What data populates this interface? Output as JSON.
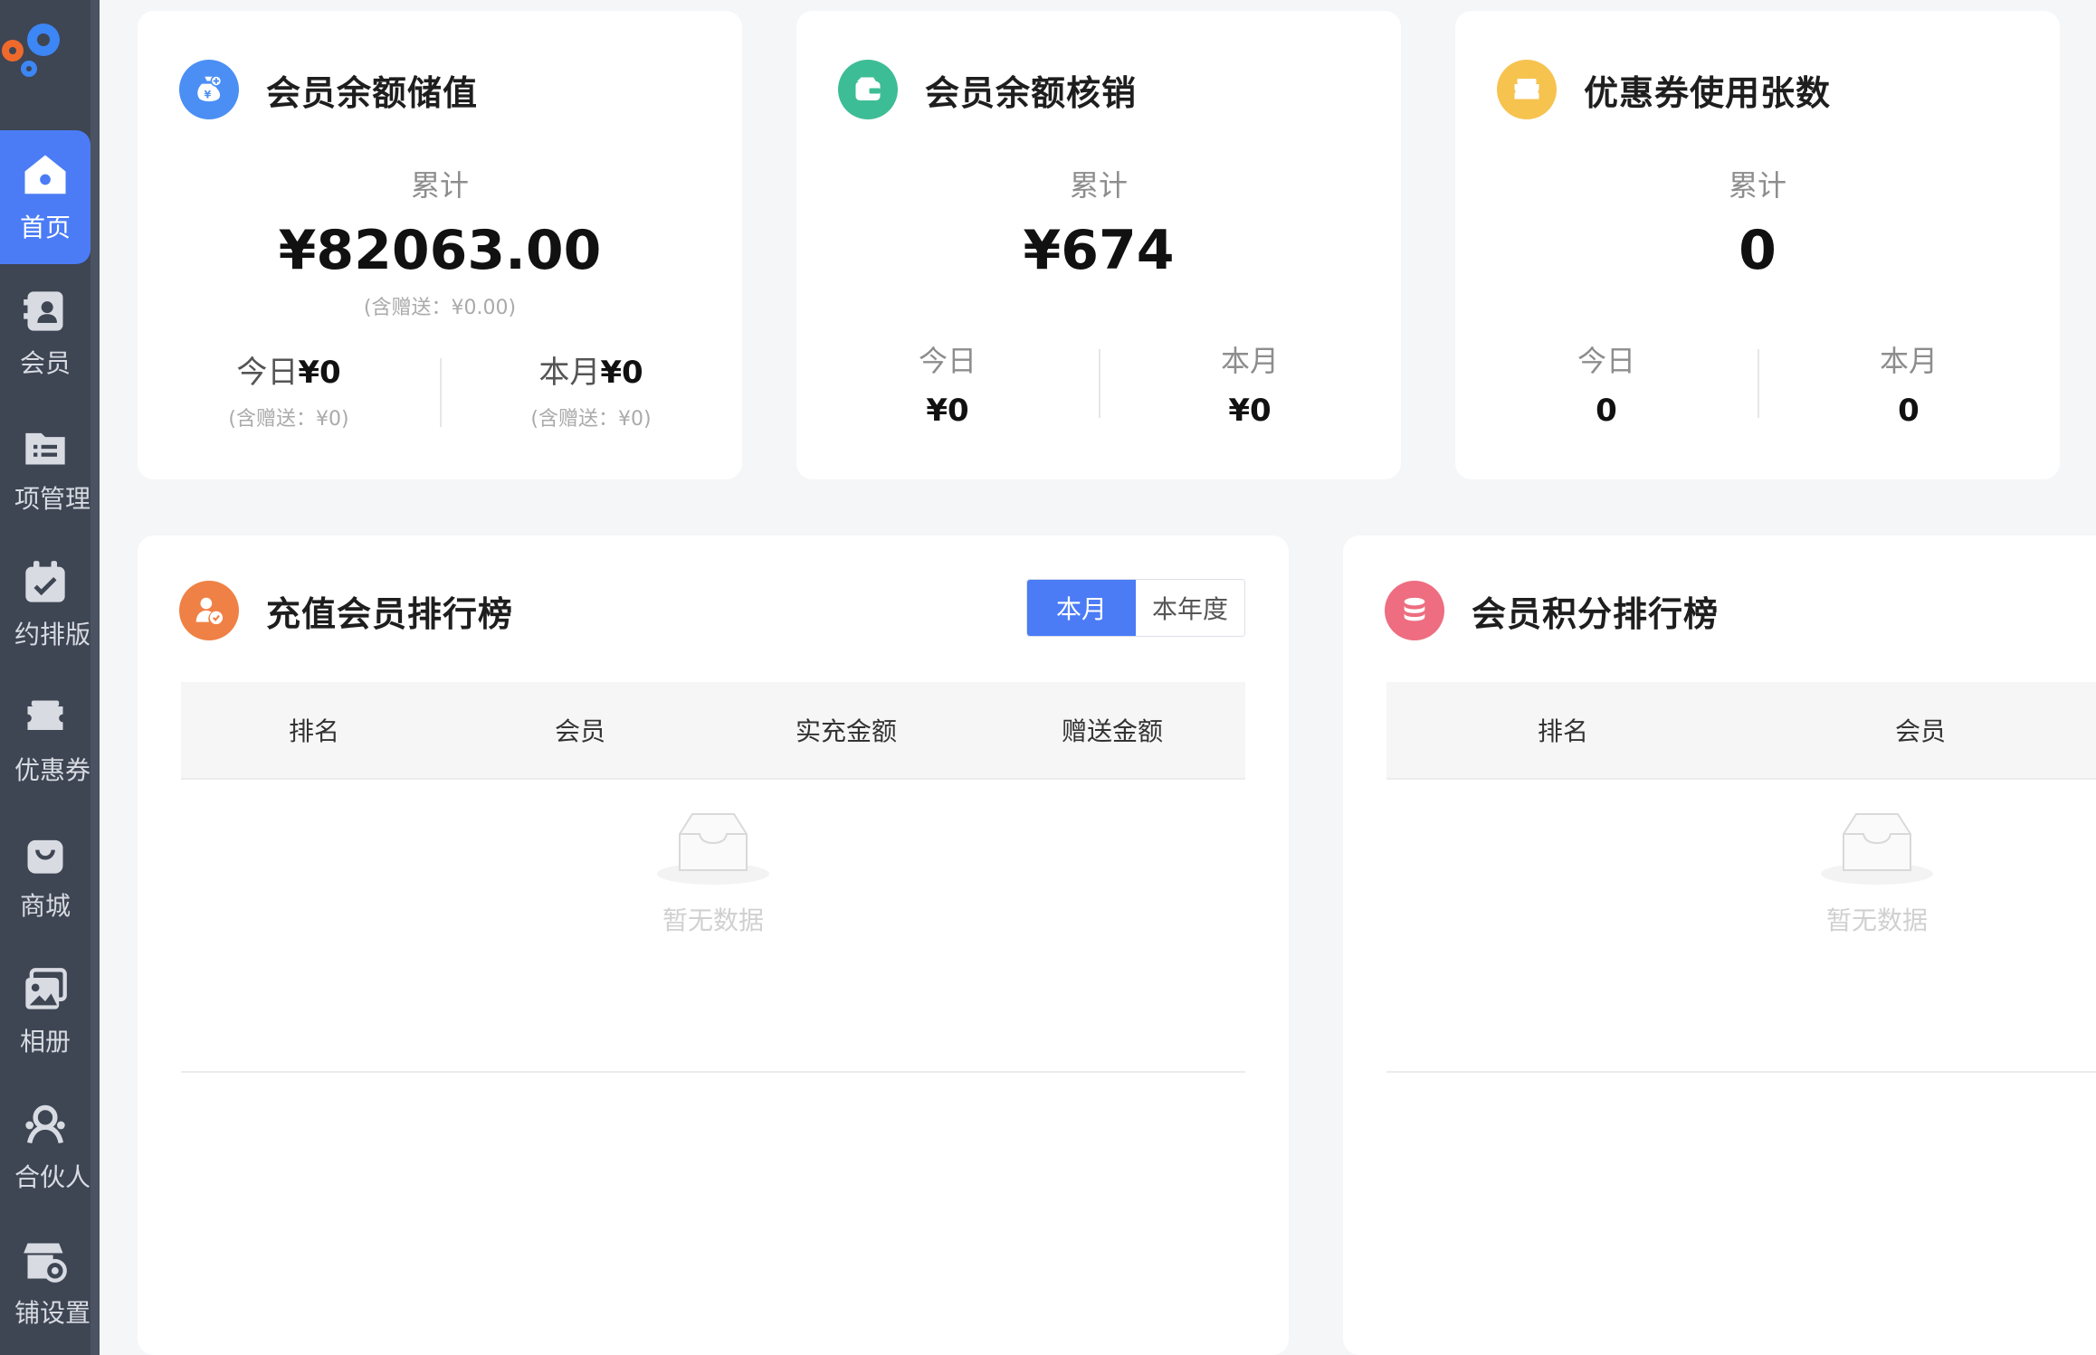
{
  "sidebar": {
    "items": [
      {
        "label": "首页",
        "icon": "home-icon",
        "active": true
      },
      {
        "label": "会员",
        "icon": "member-card-icon"
      },
      {
        "label": "项管理",
        "icon": "project-list-icon"
      },
      {
        "label": "约排版",
        "icon": "calendar-icon"
      },
      {
        "label": "优惠券",
        "icon": "coupon-ticket-icon"
      },
      {
        "label": "商城",
        "icon": "shopping-bag-icon"
      },
      {
        "label": "相册",
        "icon": "photo-album-icon"
      },
      {
        "label": "合伙人",
        "icon": "partner-icon"
      },
      {
        "label": "铺设置",
        "icon": "store-settings-icon"
      }
    ]
  },
  "cards": {
    "deposit": {
      "title": "会员余额储值",
      "cum_label": "累计",
      "cum_value": "¥82063.00",
      "cum_sub": "(含赠送：¥0.00)",
      "today_label": "今日",
      "today_value": "¥0",
      "today_sub": "(含赠送：¥0)",
      "month_label": "本月",
      "month_value": "¥0",
      "month_sub": "(含赠送：¥0)",
      "color": "#4b8ff5"
    },
    "writeoff": {
      "title": "会员余额核销",
      "cum_label": "累计",
      "cum_value": "¥674",
      "today_label": "今日",
      "today_value": "¥0",
      "month_label": "本月",
      "month_value": "¥0",
      "color": "#3dbd95"
    },
    "coupon": {
      "title": "优惠券使用张数",
      "cum_label": "累计",
      "cum_value": "0",
      "today_label": "今日",
      "today_value": "0",
      "month_label": "本月",
      "month_value": "0",
      "color": "#f6c34f"
    }
  },
  "recharge_rank": {
    "title": "充值会员排行榜",
    "tabs": [
      "本月",
      "本年度"
    ],
    "active_tab": "本月",
    "columns": [
      "排名",
      "会员",
      "实充金额",
      "赠送金额"
    ],
    "empty_text": "暂无数据",
    "color": "#ef8146"
  },
  "points_rank": {
    "title": "会员积分排行榜",
    "columns": [
      "排名",
      "会员"
    ],
    "empty_text": "暂无数据",
    "color": "#ee6d80"
  }
}
